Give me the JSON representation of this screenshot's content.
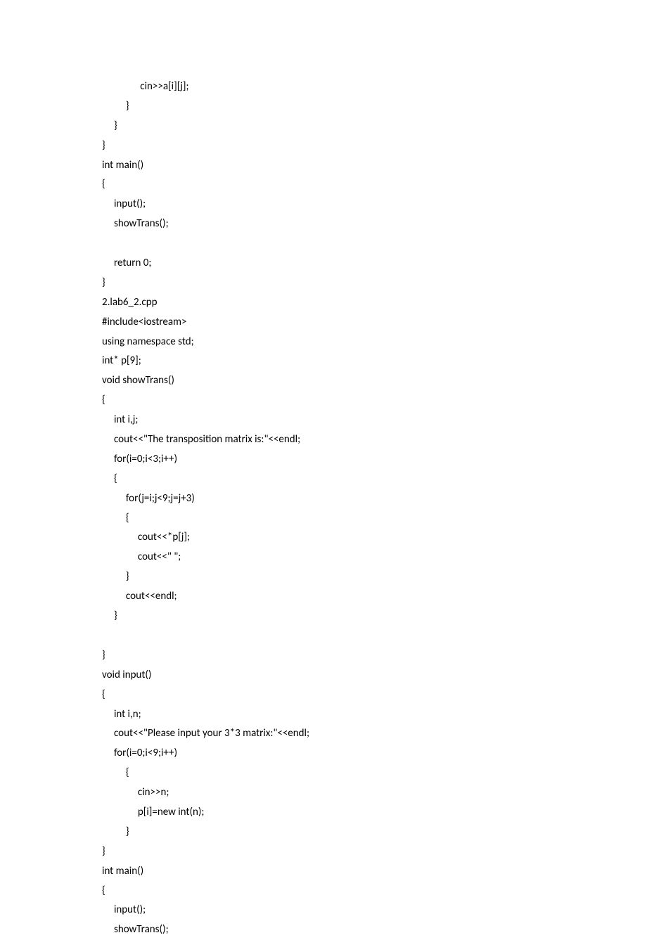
{
  "code": {
    "lines": [
      "                cin>>a[i][j];",
      "          }",
      "     }",
      "}",
      "int main()",
      "{",
      "     input();",
      "     showTrans();",
      "",
      "     return 0;",
      "}",
      "2.lab6_2.cpp",
      "#include<iostream>",
      "using namespace std;",
      "int* p[9];",
      "void showTrans()",
      "{",
      "     int i,j;",
      "     cout<<\"The transposition matrix is:\"<<endl;",
      "     for(i=0;i<3;i++)",
      "     {",
      "          for(j=i;j<9;j=j+3)",
      "          {",
      "               cout<<*p[j];",
      "               cout<<\" \";",
      "          }",
      "          cout<<endl;",
      "     }",
      "",
      "}",
      "void input()",
      "{",
      "     int i,n;",
      "     cout<<\"Please input your 3*3 matrix:\"<<endl;",
      "     for(i=0;i<9;i++)",
      "          {",
      "               cin>>n;",
      "               p[i]=new int(n);",
      "          }",
      "}",
      "int main()",
      "{",
      "     input();",
      "     showTrans();"
    ]
  }
}
